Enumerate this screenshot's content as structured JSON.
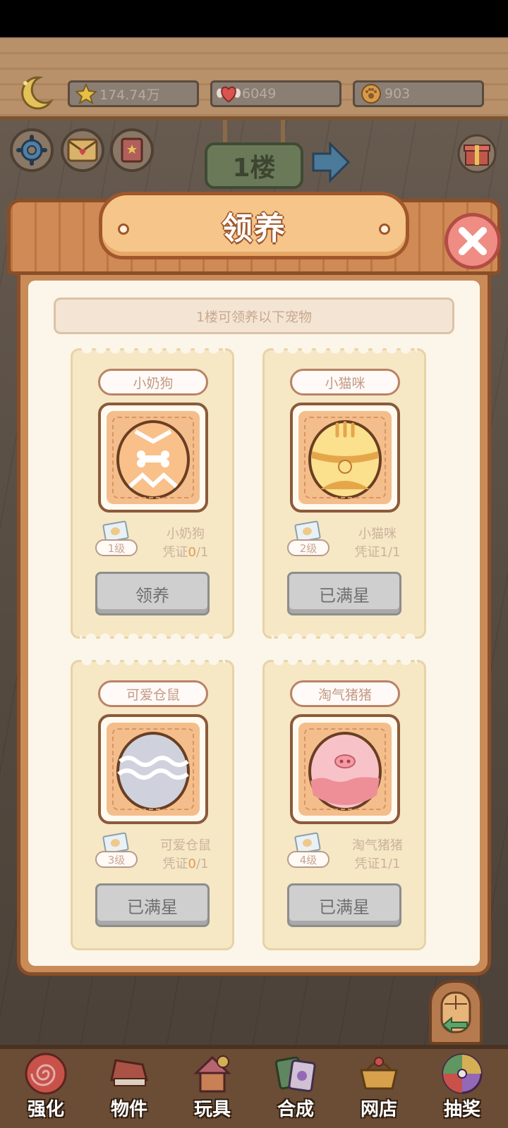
{
  "header": {
    "resources": [
      {
        "icon": "star-icon",
        "value": "174.74万"
      },
      {
        "icon": "heart-wings-icon",
        "value": "6049"
      },
      {
        "icon": "paw-coin-icon",
        "value": "903"
      }
    ],
    "floor_label": "1楼"
  },
  "modal": {
    "title": "领养",
    "subtitle": "1楼可领养以下宠物",
    "pets": [
      {
        "name": "小奶狗",
        "level": "1级",
        "voucher_name": "小奶狗",
        "voucher_prefix": "凭证",
        "voucher_have": "0",
        "voucher_need": "/1",
        "button": "领养",
        "egg_color": "#f9c08a"
      },
      {
        "name": "小猫咪",
        "level": "2级",
        "voucher_name": "小猫咪",
        "voucher_prefix": "凭证",
        "voucher_have": "1",
        "voucher_need": "/1",
        "button": "已满星",
        "egg_color": "#fbe08e"
      },
      {
        "name": "可爱仓鼠",
        "level": "3级",
        "voucher_name": "可爱仓鼠",
        "voucher_prefix": "凭证",
        "voucher_have": "0",
        "voucher_need": "/1",
        "button": "已满星",
        "egg_color": "#cfd2dc"
      },
      {
        "name": "淘气猪猪",
        "level": "4级",
        "voucher_name": "淘气猪猪",
        "voucher_prefix": "凭证",
        "voucher_have": "1",
        "voucher_need": "/1",
        "button": "已满星",
        "egg_color": "#f7c3c8"
      }
    ]
  },
  "bottom_nav": [
    {
      "label": "强化",
      "icon": "spiral-candy-icon",
      "color": "#d9534f"
    },
    {
      "label": "物件",
      "icon": "piano-icon",
      "color": "#b5544a"
    },
    {
      "label": "玩具",
      "icon": "cat-house-icon",
      "color": "#c46a7a"
    },
    {
      "label": "合成",
      "icon": "cards-icon",
      "color": "#5f8f6a"
    },
    {
      "label": "网店",
      "icon": "shop-basket-icon",
      "color": "#e9b04f"
    },
    {
      "label": "抽奖",
      "icon": "lottery-wheel-icon",
      "color": "#9b6fcf"
    }
  ]
}
